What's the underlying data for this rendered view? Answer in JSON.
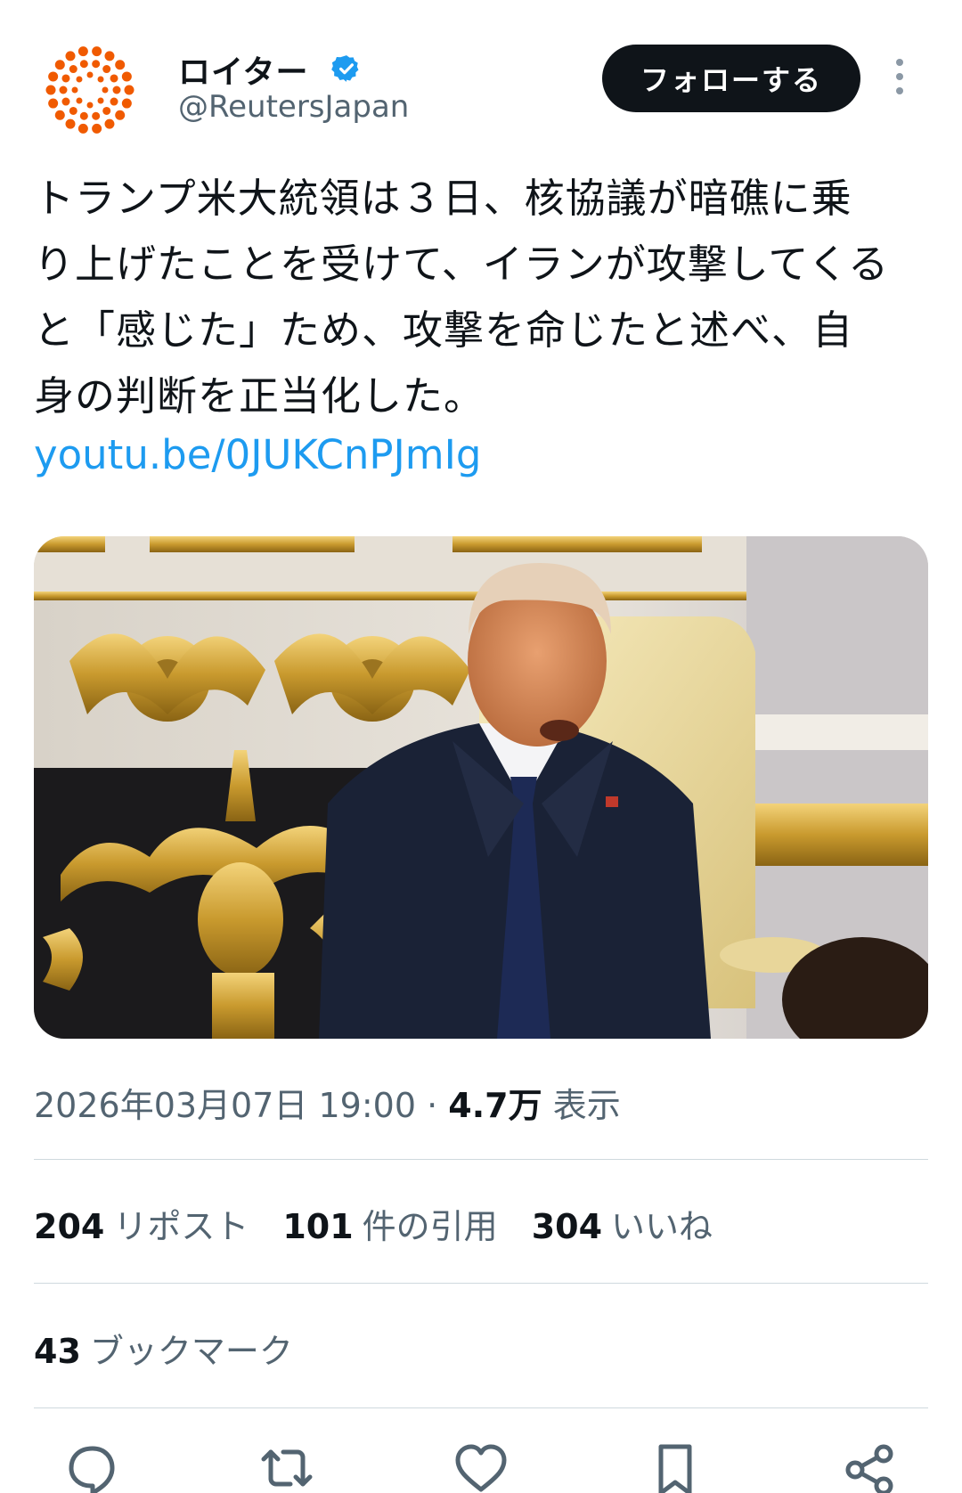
{
  "author": {
    "display_name": "ロイター",
    "handle": "@ReutersJapan",
    "verified_icon": "verified-badge-icon",
    "avatar_color": "#f05a00"
  },
  "header": {
    "follow_label": "フォローする",
    "more_icon": "more-vertical-icon"
  },
  "tweet": {
    "text": "トランプ米大統領は３日、核協議が暗礁に乗\nり上げたことを受けて、イランが攻撃してくる\nと「感じた」ため、攻撃を命じたと述べ、自\n身の判断を正当化した。",
    "link": "youtu.be/0JUKCnPJmIg",
    "link_color": "#1d9bf0"
  },
  "meta": {
    "timestamp": "2026年03月07日 19:00",
    "separator": " · ",
    "views_count": "4.7万",
    "views_label": "表示"
  },
  "stats": {
    "reposts_count": "204",
    "reposts_label": "リポスト",
    "quotes_count": "101",
    "quotes_label": "件の引用",
    "likes_count": "304",
    "likes_label": "いいね",
    "bookmarks_count": "43",
    "bookmarks_label": "ブックマーク"
  },
  "actions": [
    "reply-icon",
    "repost-icon",
    "like-icon",
    "bookmark-icon",
    "share-icon"
  ]
}
